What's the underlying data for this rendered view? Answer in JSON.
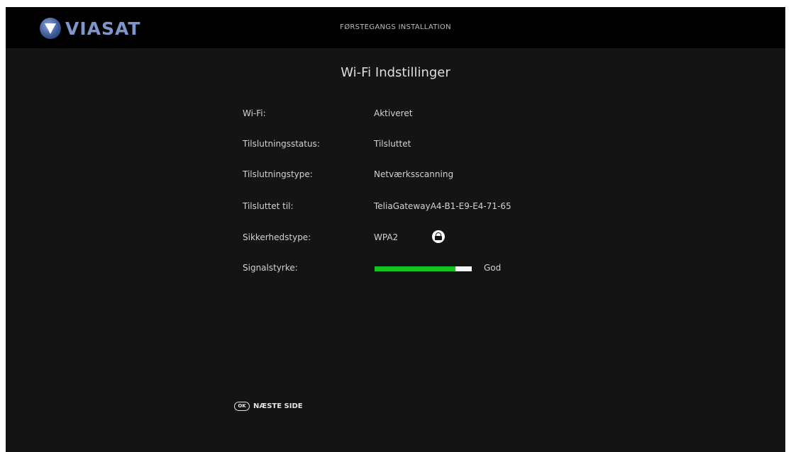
{
  "header": {
    "logo_text": "VIASAT",
    "title": "FØRSTEGANGS INSTALLATION"
  },
  "page": {
    "title": "Wi-Fi  Indstillinger"
  },
  "settings": [
    {
      "label": "Wi-Fi:",
      "value": "Aktiveret"
    },
    {
      "label": "Tilslutningsstatus:",
      "value": "Tilsluttet"
    },
    {
      "label": "Tilslutningstype:",
      "value": "Netværksscanning"
    },
    {
      "label": "Tilsluttet til:",
      "value": "TeliaGatewayA4-B1-E9-E4-71-65"
    },
    {
      "label": "Sikkerhedstype:",
      "value": "WPA2",
      "icon": "lock-icon"
    },
    {
      "label": "Signalstyrke:",
      "value": "God",
      "signal_level": 0.83
    }
  ],
  "footer": {
    "ok_key": "OK",
    "next_label": "NÆSTE SIDE"
  },
  "colors": {
    "signal_fill": "#16c421",
    "logo": "#7e96c9",
    "background": "#141414",
    "topbar": "#000000"
  }
}
